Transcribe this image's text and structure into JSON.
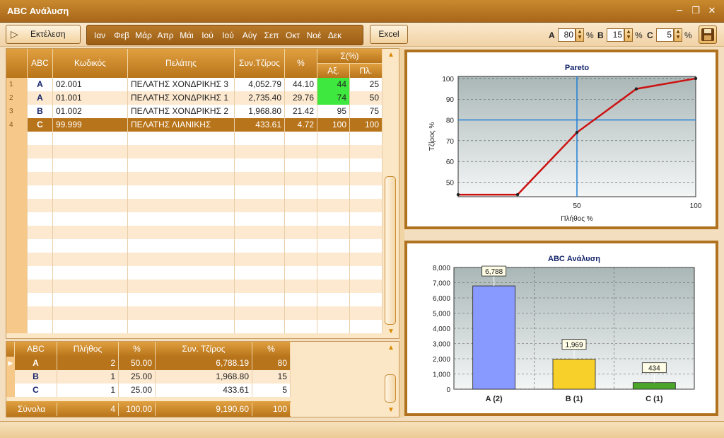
{
  "window": {
    "title": "ABC Ανάλυση"
  },
  "toolbar": {
    "run_label": "Εκτέλεση",
    "months": [
      "Ιαν",
      "Φεβ",
      "Μάρ",
      "Απρ",
      "Μάι",
      "Ιού",
      "Ιού",
      "Αύγ",
      "Σεπ",
      "Οκτ",
      "Νοέ",
      "Δεκ"
    ],
    "excel_label": "Excel",
    "params": [
      {
        "label": "A",
        "value": "80",
        "unit": "%"
      },
      {
        "label": "B",
        "value": "15",
        "unit": "%"
      },
      {
        "label": "C",
        "value": "5",
        "unit": "%"
      }
    ]
  },
  "main_grid": {
    "headers": {
      "abc": "ABC",
      "code": "Κωδικός",
      "customer": "Πελάτης",
      "turnover": "Συν.Τζίρος",
      "pct": "%",
      "sum_group": "Σ(%)",
      "sum_value": "Αξ.",
      "sum_count": "Πλ."
    },
    "rows": [
      {
        "num": "1",
        "abc": "A",
        "code": "02.001",
        "customer": "ΠΕΛΑΤΗΣ ΧΟΝΔΡΙΚΗΣ 3",
        "turnover": "4,052.79",
        "pct": "44.10",
        "cum_value": "44",
        "cum_count": "25",
        "highlight": "#3ee83e"
      },
      {
        "num": "2",
        "abc": "A",
        "code": "01.001",
        "customer": "ΠΕΛΑΤΗΣ ΧΟΝΔΡΙΚΗΣ 1",
        "turnover": "2,735.40",
        "pct": "29.76",
        "cum_value": "74",
        "cum_count": "50",
        "highlight": "#3ee83e"
      },
      {
        "num": "3",
        "abc": "B",
        "code": "01.002",
        "customer": "ΠΕΛΑΤΗΣ ΧΟΝΔΡΙΚΗΣ 2",
        "turnover": "1,968.80",
        "pct": "21.42",
        "cum_value": "95",
        "cum_count": "75",
        "highlight": ""
      },
      {
        "num": "4",
        "abc": "C",
        "code": "99.999",
        "customer": "ΠΕΛΑΤΗΣ ΛΙΑΝΙΚΗΣ",
        "turnover": "433.61",
        "pct": "4.72",
        "cum_value": "100",
        "cum_count": "100",
        "highlight": ""
      }
    ],
    "selected_row_color": "#b8741a"
  },
  "summary_grid": {
    "headers": {
      "abc": "ABC",
      "count": "Πλήθος",
      "pct": "%",
      "turnover": "Συν. Τζίρος",
      "target_pct": "%"
    },
    "rows": [
      {
        "abc": "A",
        "count": "2",
        "pct": "50.00",
        "turnover": "6,788.19",
        "target_pct": "80"
      },
      {
        "abc": "B",
        "count": "1",
        "pct": "25.00",
        "turnover": "1,968.80",
        "target_pct": "15"
      },
      {
        "abc": "C",
        "count": "1",
        "pct": "25.00",
        "turnover": "433.61",
        "target_pct": "5"
      }
    ],
    "totals": {
      "label": "Σύνολα",
      "count": "4",
      "pct": "100.00",
      "turnover": "9,190.60",
      "target_pct": "100"
    }
  },
  "chart_data": [
    {
      "type": "line",
      "title": "Pareto",
      "xlabel": "Πλήθος %",
      "ylabel": "Τζίρος %",
      "x": [
        0,
        25,
        50,
        75,
        100
      ],
      "series": [
        {
          "values": [
            44,
            44,
            74,
            95,
            100
          ]
        }
      ],
      "xlim": [
        0,
        100
      ],
      "ylim": [
        43,
        101
      ],
      "yticks": [
        50,
        60,
        70,
        80,
        90,
        100
      ],
      "xticks": [
        50,
        100
      ],
      "crosshair": {
        "x": 50,
        "y": 80
      },
      "grid": true,
      "line_color": "#cc1111",
      "crosshair_color": "#1e7fd6"
    },
    {
      "type": "bar",
      "title": "ABC Ανάλυση",
      "categories": [
        "A (2)",
        "B (1)",
        "C (1)"
      ],
      "values": [
        6788.19,
        1968.8,
        433.61
      ],
      "data_labels": [
        "6,788",
        "1,969",
        "434"
      ],
      "colors": [
        "#8899ff",
        "#f8d02a",
        "#4aa52a"
      ],
      "ylim": [
        0,
        8000
      ],
      "yticks": [
        "0",
        "1,000",
        "2,000",
        "3,000",
        "4,000",
        "5,000",
        "6,000",
        "7,000",
        "8,000"
      ],
      "grid": true
    }
  ]
}
